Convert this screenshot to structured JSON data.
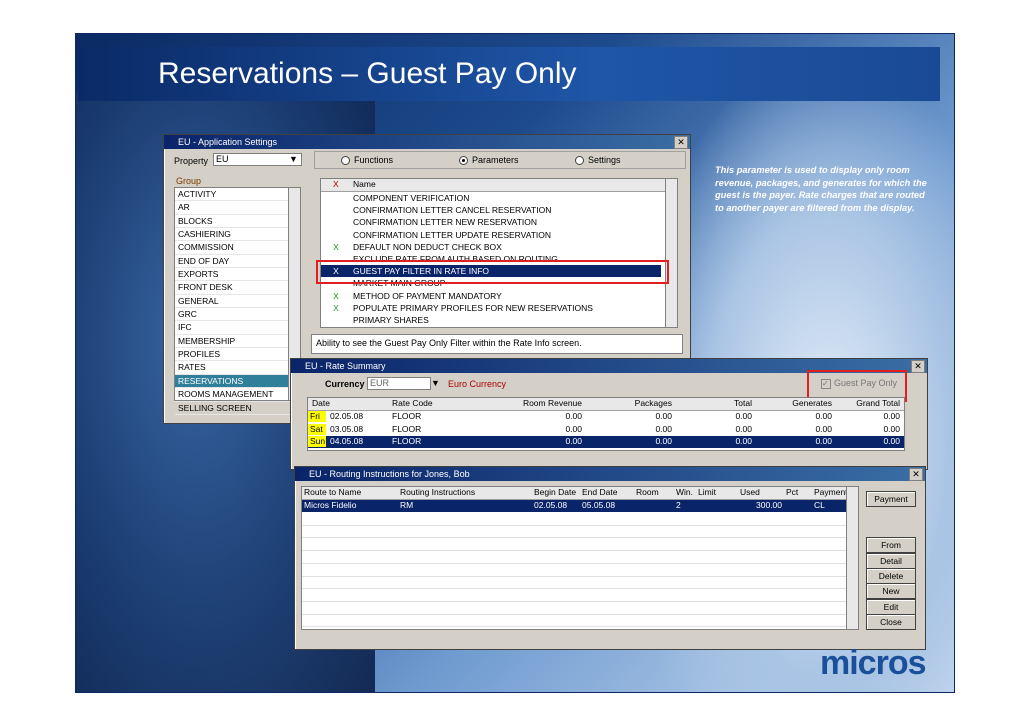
{
  "slide": {
    "title": "Reservations – Guest Pay Only",
    "note": "This parameter is used to display only room revenue, packages, and generates for which the guest is the payer. Rate charges that are routed to another payer are filtered from the display.",
    "logo": "micros"
  },
  "app_settings": {
    "title": "EU - Application Settings",
    "property_label": "Property",
    "property_value": "EU",
    "radio_functions": "Functions",
    "radio_parameters": "Parameters",
    "radio_settings": "Settings",
    "group_header": "Group",
    "groups": [
      "ACTIVITY",
      "AR",
      "BLOCKS",
      "CASHIERING",
      "COMMISSION",
      "END OF DAY",
      "EXPORTS",
      "FRONT DESK",
      "GENERAL",
      "GRC",
      "IFC",
      "MEMBERSHIP",
      "PROFILES",
      "RATES",
      "RESERVATIONS",
      "ROOMS MANAGEMENT",
      "SELLING SCREEN"
    ],
    "selected_group": "RESERVATIONS",
    "col_x": "X",
    "col_name": "Name",
    "params": [
      {
        "x": "",
        "name": "COMPONENT VERIFICATION"
      },
      {
        "x": "",
        "name": "CONFIRMATION LETTER CANCEL RESERVATION"
      },
      {
        "x": "",
        "name": "CONFIRMATION LETTER NEW RESERVATION"
      },
      {
        "x": "",
        "name": "CONFIRMATION LETTER UPDATE RESERVATION"
      },
      {
        "x": "X",
        "name": "DEFAULT NON DEDUCT CHECK BOX"
      },
      {
        "x": "",
        "name": "EXCLUDE RATE FROM AUTH BASED ON ROUTING"
      },
      {
        "x": "X",
        "name": "GUEST PAY FILTER IN RATE INFO"
      },
      {
        "x": "",
        "name": "MARKET MAIN GROUP"
      },
      {
        "x": "X",
        "name": "METHOD OF PAYMENT MANDATORY"
      },
      {
        "x": "X",
        "name": "POPULATE PRIMARY PROFILES FOR NEW RESERVATIONS"
      },
      {
        "x": "",
        "name": "PRIMARY SHARES"
      }
    ],
    "description": "Ability to see the Guest Pay Only Filter within the Rate Info screen."
  },
  "rate_summary": {
    "title": "EU - Rate Summary",
    "currency_label": "Currency",
    "currency_value": "EUR",
    "currency_name": "Euro Currency",
    "guest_pay_only": "Guest Pay Only",
    "columns": [
      "Date",
      "Rate Code",
      "Room Revenue",
      "Packages",
      "Total",
      "Generates",
      "Grand Total"
    ],
    "rows": [
      {
        "day": "Fri",
        "date": "02.05.08",
        "code": "FLOOR",
        "rev": "0.00",
        "pkg": "0.00",
        "total": "0.00",
        "gen": "0.00",
        "grand": "0.00"
      },
      {
        "day": "Sat",
        "date": "03.05.08",
        "code": "FLOOR",
        "rev": "0.00",
        "pkg": "0.00",
        "total": "0.00",
        "gen": "0.00",
        "grand": "0.00"
      },
      {
        "day": "Sun",
        "date": "04.05.08",
        "code": "FLOOR",
        "rev": "0.00",
        "pkg": "0.00",
        "total": "0.00",
        "gen": "0.00",
        "grand": "0.00"
      }
    ]
  },
  "routing": {
    "title": "EU - Routing Instructions for Jones, Bob",
    "columns": [
      "Route to Name",
      "Routing Instructions",
      "Begin Date",
      "End Date",
      "Room",
      "Win.",
      "Limit",
      "Used",
      "Pct",
      "Payment"
    ],
    "row": {
      "name": "Micros Fidelio",
      "instr": "RM",
      "begin": "02.05.08",
      "end": "05.05.08",
      "room": "",
      "win": "2",
      "limit": "",
      "used": "300.00",
      "pct": "",
      "payment": "CL"
    },
    "buttons": [
      "Payment",
      "From",
      "Detail",
      "Delete",
      "New",
      "Edit",
      "Close"
    ]
  }
}
